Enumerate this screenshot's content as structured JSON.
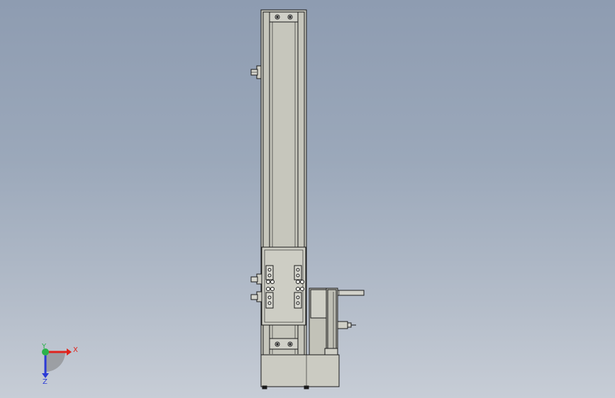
{
  "viewport": {
    "background_top": "#8e9cb1",
    "background_bottom": "#c7cdd6",
    "model_color": "#c9c9c0",
    "model_shadow": "#b3b3aa",
    "edge_color": "#1a1a1a"
  },
  "triad": {
    "x_label": "X",
    "y_label": "Y",
    "z_label": "Z",
    "x_color": "#e0231c",
    "y_color": "#2bb24a",
    "z_color": "#2b3ad6"
  }
}
